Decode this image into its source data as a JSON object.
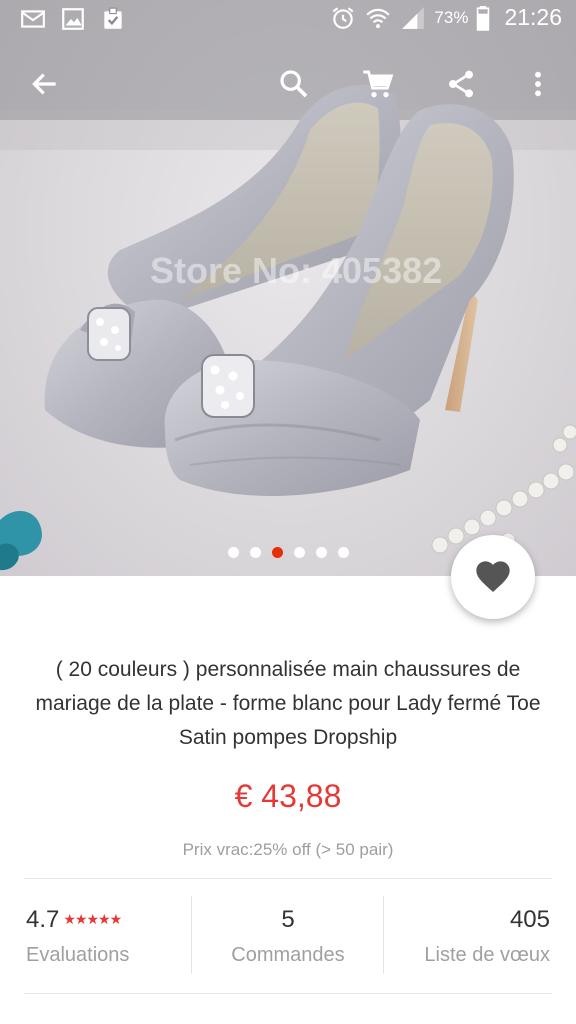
{
  "status_bar": {
    "battery_text": "73%",
    "time": "21:26",
    "left_icons": [
      "mail-icon",
      "image-icon",
      "clipboard-check-icon"
    ],
    "right_icons": [
      "alarm-icon",
      "wifi-icon",
      "signal-icon",
      "battery-icon"
    ]
  },
  "toolbar": {
    "icons": [
      "back-arrow-icon",
      "search-icon",
      "cart-icon",
      "share-icon",
      "more-vert-icon"
    ]
  },
  "gallery": {
    "watermark": "Store No: 405382",
    "dot_count": 6,
    "active_dot": 2
  },
  "favorite": {
    "icon": "heart-icon"
  },
  "product": {
    "title": "( 20 couleurs ) personnalisée main chaussures de mariage de la plate - forme blanc pour Lady fermé Toe Satin pompes Dropship",
    "price": "€ 43,88",
    "bulk_price": "Prix vrac:25% off (> 50 pair)"
  },
  "stats": {
    "rating": {
      "value": "4.7",
      "stars": "★★★★★",
      "label": "Evaluations"
    },
    "orders": {
      "value": "5",
      "label": "Commandes"
    },
    "wishlist": {
      "value": "405",
      "label": "Liste de vœux"
    }
  },
  "colors": {
    "accent": "#e53935",
    "active_dot": "#e62e04"
  }
}
